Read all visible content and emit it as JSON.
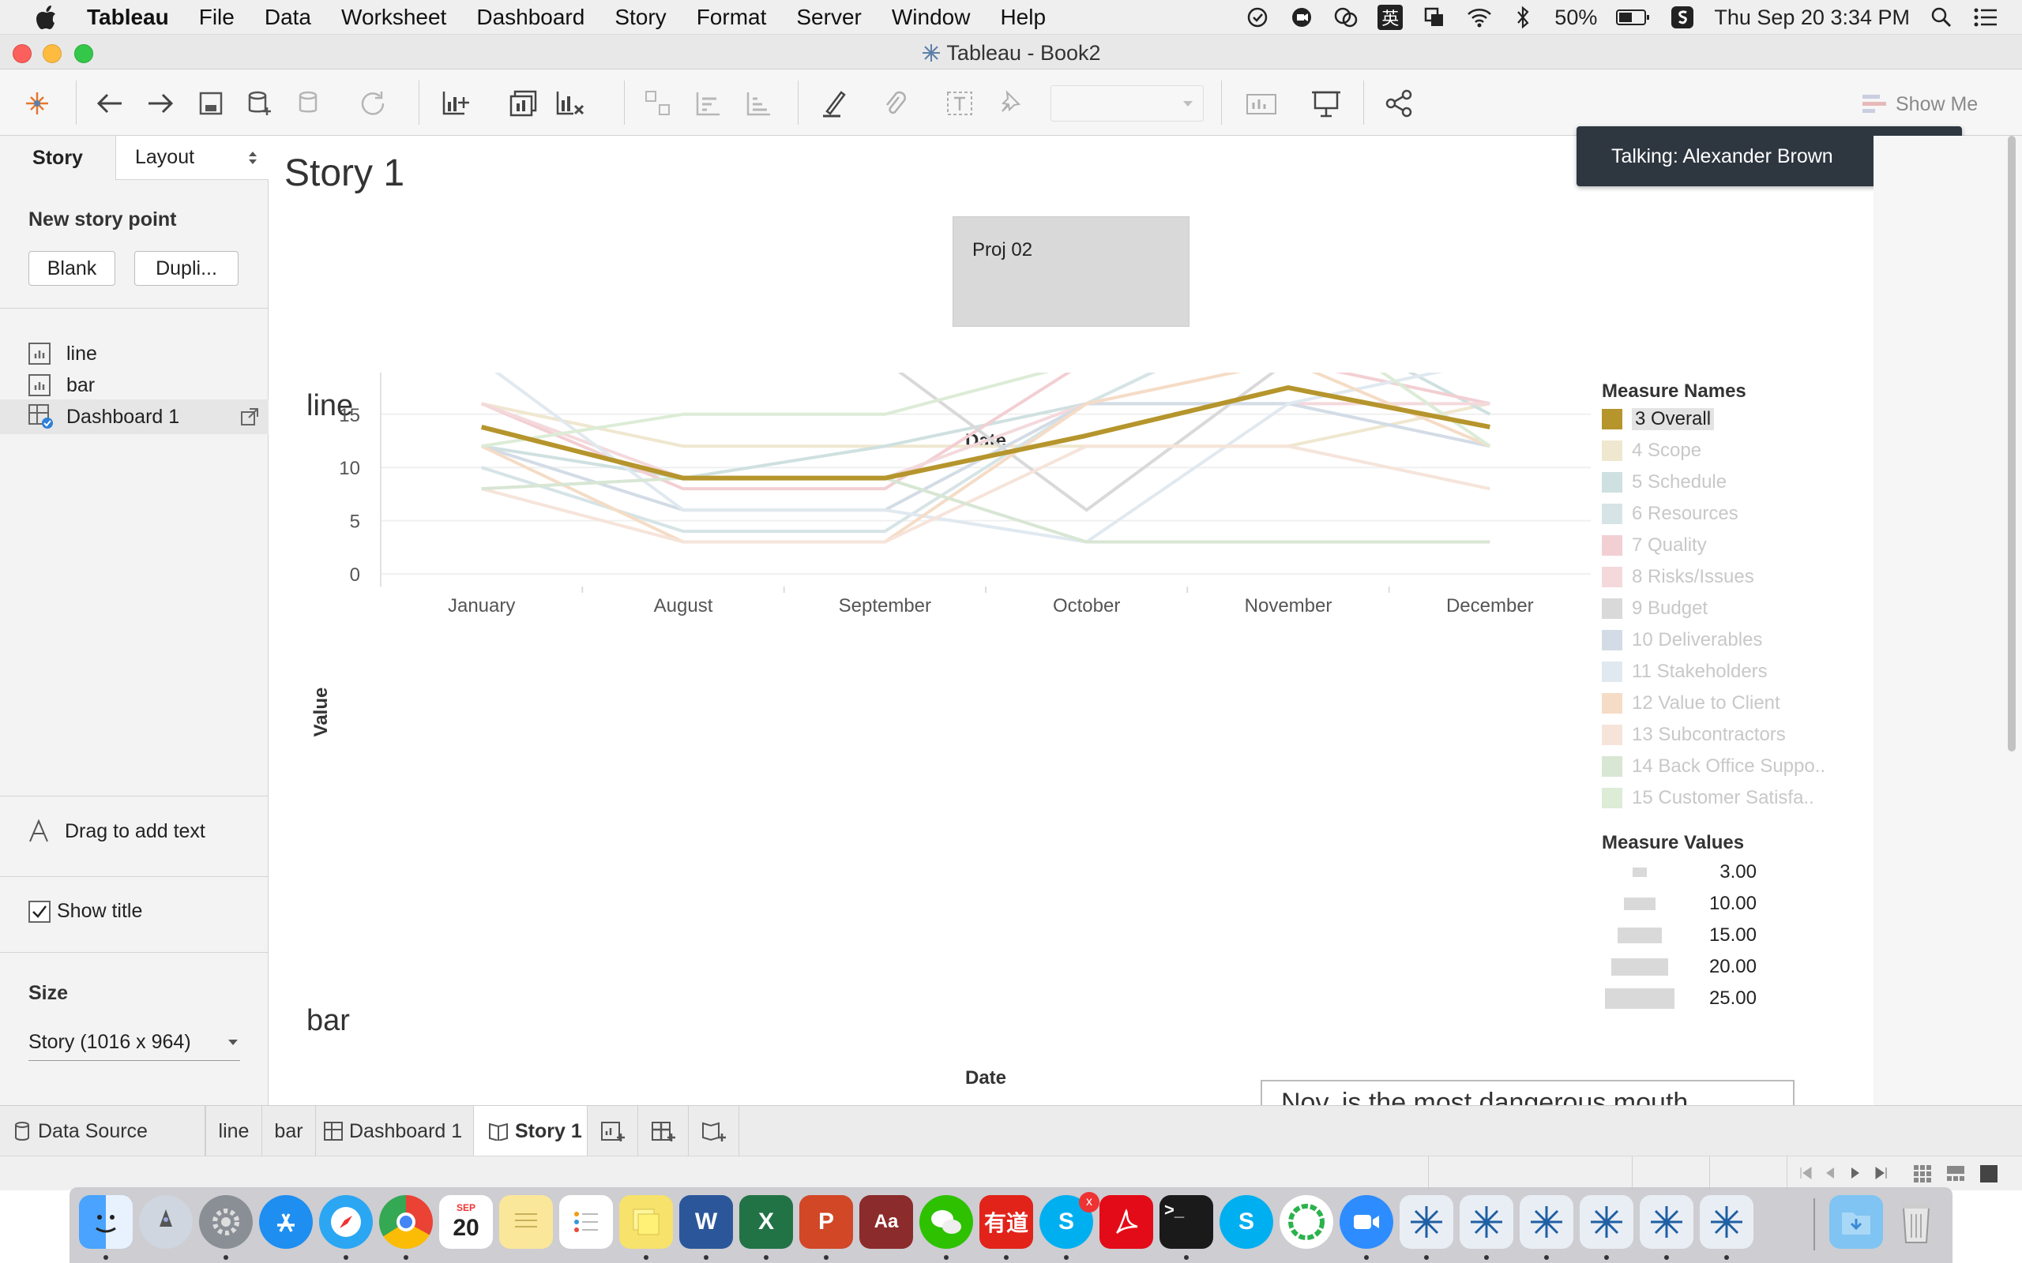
{
  "menubar": {
    "app": "Tableau",
    "items": [
      "File",
      "Data",
      "Worksheet",
      "Dashboard",
      "Story",
      "Format",
      "Server",
      "Window",
      "Help"
    ],
    "battery": "50%",
    "datetime": "Thu Sep 20  3:34 PM",
    "ime": "英"
  },
  "window": {
    "title": "Tableau - Book2"
  },
  "toolbar": {
    "show_me": "Show Me"
  },
  "left": {
    "tab_story": "Story",
    "tab_layout": "Layout",
    "new_story_point": "New story point",
    "blank": "Blank",
    "duplicate": "Dupli...",
    "sheets": [
      "line",
      "bar",
      "Dashboard 1"
    ],
    "drag_text": "Drag to add text",
    "show_title": "Show title",
    "size_label": "Size",
    "size_value": "Story (1016 x 964)"
  },
  "story": {
    "title": "Story 1",
    "point": "Proj 02",
    "line_title": "line",
    "bar_title": "bar",
    "bar_axis_title": "Date",
    "annotation": "Nov. is the most dangerous mouth"
  },
  "notification": "Talking: Alexander Brown",
  "legend": {
    "title": "Measure Names",
    "items": [
      {
        "label": "3 Overall",
        "color": "#b5952c"
      },
      {
        "label": "4 Scope",
        "color": "#efe7cf"
      },
      {
        "label": "5 Schedule",
        "color": "#cfe0e0"
      },
      {
        "label": "6 Resources",
        "color": "#d6e4e6"
      },
      {
        "label": "7 Quality",
        "color": "#f2cfd3"
      },
      {
        "label": "8 Risks/Issues",
        "color": "#f4d9dc"
      },
      {
        "label": "9 Budget",
        "color": "#d9d9d9"
      },
      {
        "label": "10 Deliverables",
        "color": "#d3dce6"
      },
      {
        "label": "11 Stakeholders",
        "color": "#e1e9f0"
      },
      {
        "label": "12 Value to Client",
        "color": "#f5dcc6"
      },
      {
        "label": "13 Subcontractors",
        "color": "#f6e4da"
      },
      {
        "label": "14 Back Office Suppo..",
        "color": "#d8e6d4"
      },
      {
        "label": "15 Customer Satisfa..",
        "color": "#dcecd6"
      }
    ],
    "size_title": "Measure Values",
    "size_items": [
      "3.00",
      "10.00",
      "15.00",
      "20.00",
      "25.00"
    ]
  },
  "tabs": [
    "Data Source",
    "line",
    "bar",
    "Dashboard 1",
    "Story 1"
  ],
  "chart_data": {
    "type": "line",
    "title": "line",
    "xlabel": "Date",
    "ylabel": "Value",
    "categories": [
      "January",
      "August",
      "September",
      "October",
      "November",
      "December"
    ],
    "ylim": [
      0,
      25
    ],
    "yticks": [
      0,
      5,
      10,
      15,
      20,
      25
    ],
    "grid": true,
    "legend": "right",
    "series": [
      {
        "name": "3 Overall",
        "color": "#b5952c",
        "values": [
          13.8,
          9,
          9,
          13,
          17.5,
          13.8
        ]
      },
      {
        "name": "4 Scope",
        "color": "#efe7cf",
        "values": [
          16,
          12,
          12,
          12,
          12,
          16
        ]
      },
      {
        "name": "5 Schedule",
        "color": "#cfe0e0",
        "values": [
          12,
          9,
          12,
          16,
          25,
          15
        ]
      },
      {
        "name": "6 Resources",
        "color": "#d6e4e6",
        "values": [
          10,
          4,
          4,
          16,
          25,
          12
        ]
      },
      {
        "name": "7 Quality",
        "color": "#f2cfd3",
        "values": [
          16,
          8,
          8,
          20,
          20,
          16
        ]
      },
      {
        "name": "8 Risks/Issues",
        "color": "#f4d9dc",
        "values": [
          16,
          9,
          9,
          16,
          16,
          16
        ]
      },
      {
        "name": "9 Budget",
        "color": "#d9d9d9",
        "values": [
          20,
          20,
          20,
          6,
          20,
          20
        ]
      },
      {
        "name": "10 Deliverables",
        "color": "#d3dce6",
        "values": [
          12,
          6,
          6,
          16,
          16,
          12
        ]
      },
      {
        "name": "11 Stakeholders",
        "color": "#e1e9f0",
        "values": [
          20,
          6,
          6,
          3,
          16,
          20
        ]
      },
      {
        "name": "12 Value to Client",
        "color": "#f5dcc6",
        "values": [
          12,
          3,
          3,
          16,
          20,
          12
        ]
      },
      {
        "name": "13 Subcontractors",
        "color": "#f6e4da",
        "values": [
          8,
          3,
          3,
          12,
          12,
          8
        ]
      },
      {
        "name": "14 Back Office Suppo..",
        "color": "#d8e6d4",
        "values": [
          8,
          9,
          9,
          3,
          3,
          3
        ]
      },
      {
        "name": "15 Customer Satisfa..",
        "color": "#dcecd6",
        "values": [
          12,
          15,
          15,
          20,
          25,
          12
        ]
      }
    ]
  }
}
